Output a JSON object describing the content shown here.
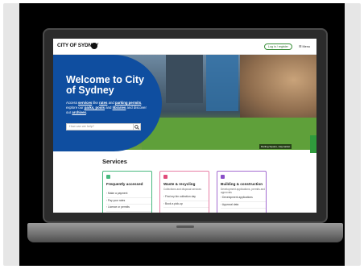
{
  "site": {
    "logo_text": "CITY OF SYDNEY",
    "login_label": "Log in / register",
    "menu_label": "Menu"
  },
  "hero": {
    "title": "Welcome to City of Sydney",
    "intro_pre": "Access ",
    "link_services": "services",
    "intro_mid1": " like ",
    "link_rates": "rates",
    "intro_mid2": " and ",
    "link_parking": "parking permits",
    "intro_mid3": ", explore our ",
    "link_parks": "parks, pools",
    "intro_mid4": " and ",
    "link_libraries": "libraries",
    "intro_mid5": " and discover our ",
    "link_archives": "archives",
    "intro_end": ".",
    "search_placeholder": "How can we help?",
    "image_caption": "Darling Square, Haymarket"
  },
  "services": {
    "title": "Services",
    "cards": [
      {
        "title": "Frequently accessed",
        "subtitle": "",
        "items": [
          "Make a payment",
          "Pay your rates",
          "Licence or permits"
        ]
      },
      {
        "title": "Waste & recycling",
        "subtitle": "Collections and disposal services",
        "items": [
          "Find my bin collection day",
          "Book a pick-up"
        ]
      },
      {
        "title": "Building & construction",
        "subtitle": "Development applications, permits and approvals",
        "items": [
          "Development applications",
          "Approval data"
        ]
      }
    ]
  },
  "colors": {
    "hero_panel": "#0f4ea0",
    "card_1_accent": "#48b97f",
    "card_2_accent": "#e14b7a",
    "card_3_accent": "#8a4fc8",
    "feedback_tab": "#2f9a3c"
  },
  "icons": [
    "search-icon",
    "logo-badge-icon",
    "menu-icon"
  ]
}
